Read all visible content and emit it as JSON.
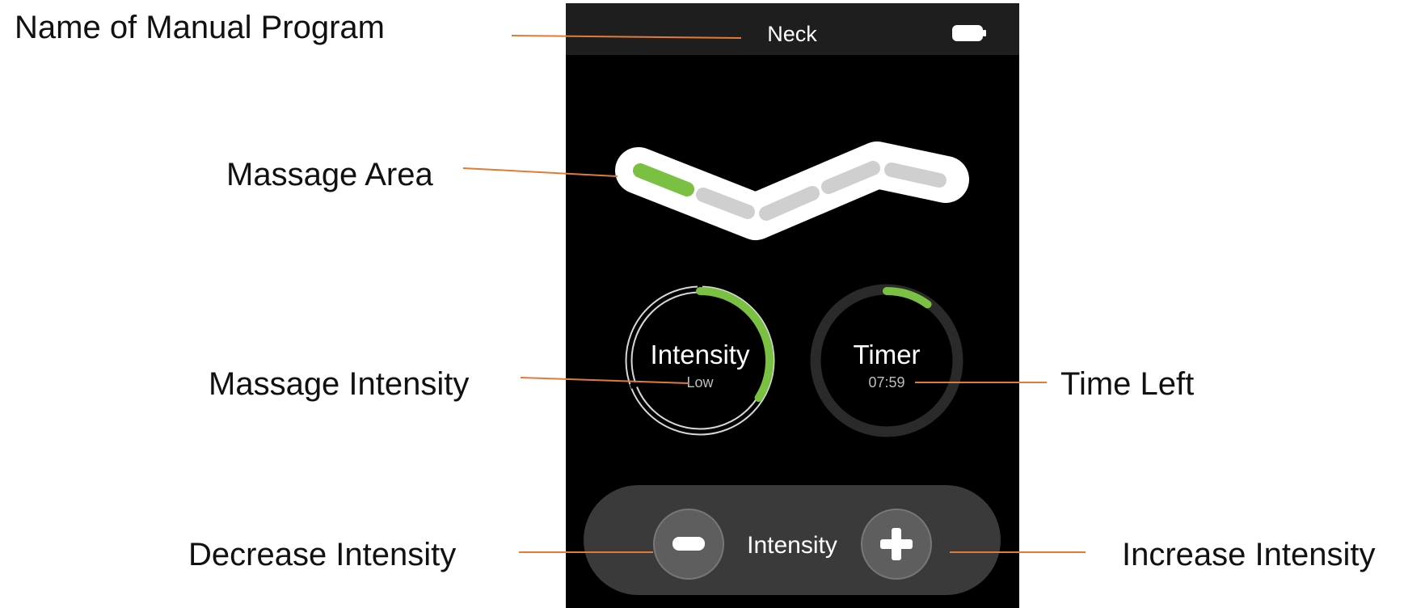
{
  "callouts": {
    "program_name": "Name of Manual Program",
    "massage_area": "Massage Area",
    "massage_intensity": "Massage Intensity",
    "decrease_intensity": "Decrease Intensity",
    "time_left": "Time Left",
    "increase_intensity": "Increase Intensity"
  },
  "device": {
    "header_title": "Neck",
    "intensity_dial": {
      "title": "Intensity",
      "value": "Low",
      "level": 0.34
    },
    "timer_dial": {
      "title": "Timer",
      "value": "07:59",
      "fraction_remaining": 0.1
    },
    "massage_area": {
      "segments": 5,
      "active_segment": 1
    },
    "controls": {
      "label": "Intensity"
    }
  },
  "colors": {
    "screen_bg": "#000000",
    "header_bg": "#1e1e1e",
    "accent_green": "#7ac143",
    "inactive_segment": "#cfcfcf",
    "leader_line": "#e07b39",
    "controls_bg": "#3a3a3a",
    "button_bg": "#5e5e5e"
  }
}
